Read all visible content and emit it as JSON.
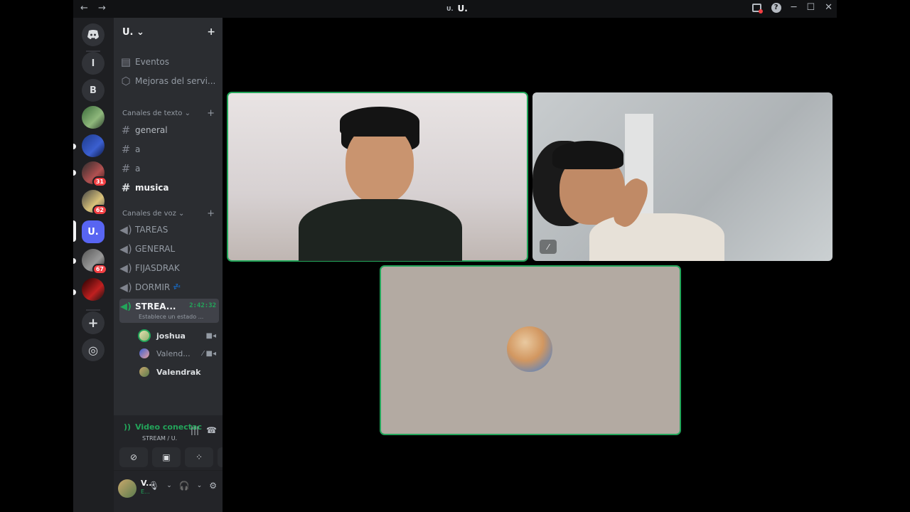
{
  "titlebar": {
    "back": "←",
    "forward": "→",
    "server_title": "U.",
    "server_icon_text": "U.",
    "minimize": "─",
    "maximize": "☐",
    "close": "✕",
    "help": "?"
  },
  "servers": [
    {
      "label": "l"
    },
    {
      "label": "B"
    },
    {
      "label": ""
    },
    {
      "label": ""
    },
    {
      "label": "",
      "badge": "31"
    },
    {
      "label": "",
      "badge": "62"
    },
    {
      "label": "U."
    },
    {
      "label": "",
      "badge": "67"
    },
    {
      "label": ""
    }
  ],
  "server_actions": {
    "add": "+",
    "explore": "◎"
  },
  "guild": {
    "name": "U. ⌄",
    "add_people": "+"
  },
  "nav": [
    {
      "label": "Eventos"
    },
    {
      "label": "Mejoras del servi..."
    }
  ],
  "text_category": {
    "label": "Canales de texto ⌄",
    "add": "+"
  },
  "text_channels": [
    {
      "name": "general"
    },
    {
      "name": "a"
    },
    {
      "name": "a"
    },
    {
      "name": "musica"
    }
  ],
  "voice_category": {
    "label": "Canales de voz ⌄",
    "add": "+"
  },
  "voice_channels": [
    {
      "name": "TAREAS"
    },
    {
      "name": "GENERAL"
    },
    {
      "name": "FIJASDRAK"
    },
    {
      "name": "DORMIR",
      "extra": "💤"
    },
    {
      "name": "STREA...",
      "timer": "2:42:32",
      "status": "Establece un estado ..."
    }
  ],
  "voice_users": [
    {
      "name": "joshua"
    },
    {
      "name": "Valend..."
    },
    {
      "name": "Valendrak"
    }
  ],
  "voice_panel": {
    "status": "Video conectac",
    "channel": "STREAM / U."
  },
  "user_panel": {
    "name": "V...",
    "status": "E..."
  },
  "colors": {
    "accent": "#5865f2",
    "green": "#23a55a",
    "red": "#f23f43"
  }
}
